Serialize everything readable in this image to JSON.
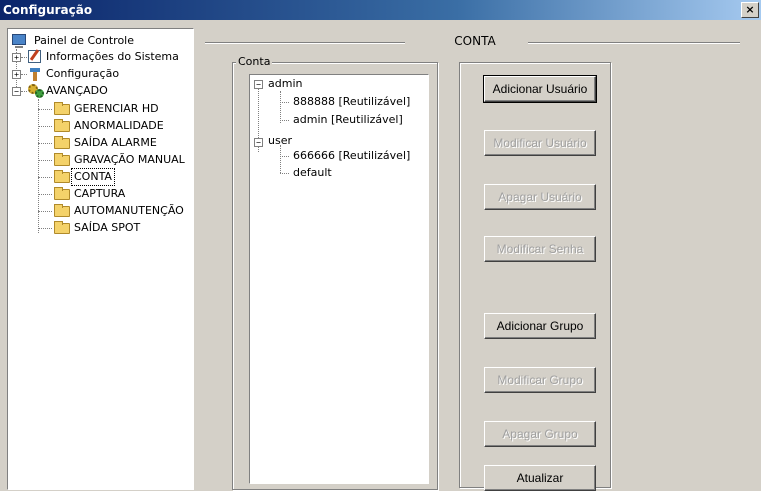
{
  "window": {
    "title": "Configuração",
    "close_label": "×"
  },
  "nav_tree": {
    "root_label": "Painel de Controle",
    "items": [
      {
        "label": "Informações do Sistema",
        "expander": "+"
      },
      {
        "label": "Configuração",
        "expander": "+"
      },
      {
        "label": "AVANÇADO",
        "expander": "−"
      }
    ],
    "advanced_children": [
      "GERENCIAR HD",
      "ANORMALIDADE",
      "SAÍDA ALARME",
      "GRAVAÇÃO MANUAL",
      "CONTA",
      "CAPTURA",
      "AUTOMANUTENÇÃO",
      "SAÍDA SPOT"
    ],
    "selected": "CONTA"
  },
  "panel": {
    "title": "CONTA",
    "group_label": "Conta",
    "account_tree": [
      {
        "label": "admin",
        "expander": "−",
        "children": [
          "888888 [Reutilizável]",
          "admin [Reutilizável]"
        ]
      },
      {
        "label": "user",
        "expander": "−",
        "children": [
          "666666 [Reutilizável]",
          "default"
        ]
      }
    ],
    "buttons": [
      {
        "label": "Adicionar Usuário",
        "enabled": true
      },
      {
        "label": "Modificar Usuário",
        "enabled": false
      },
      {
        "label": "Apagar Usuário",
        "enabled": false
      },
      {
        "label": "Modificar Senha",
        "enabled": false
      },
      {
        "label": "Adicionar Grupo",
        "enabled": true
      },
      {
        "label": "Modificar Grupo",
        "enabled": false
      },
      {
        "label": "Apagar Grupo",
        "enabled": false
      },
      {
        "label": "Atualizar",
        "enabled": true
      }
    ]
  }
}
